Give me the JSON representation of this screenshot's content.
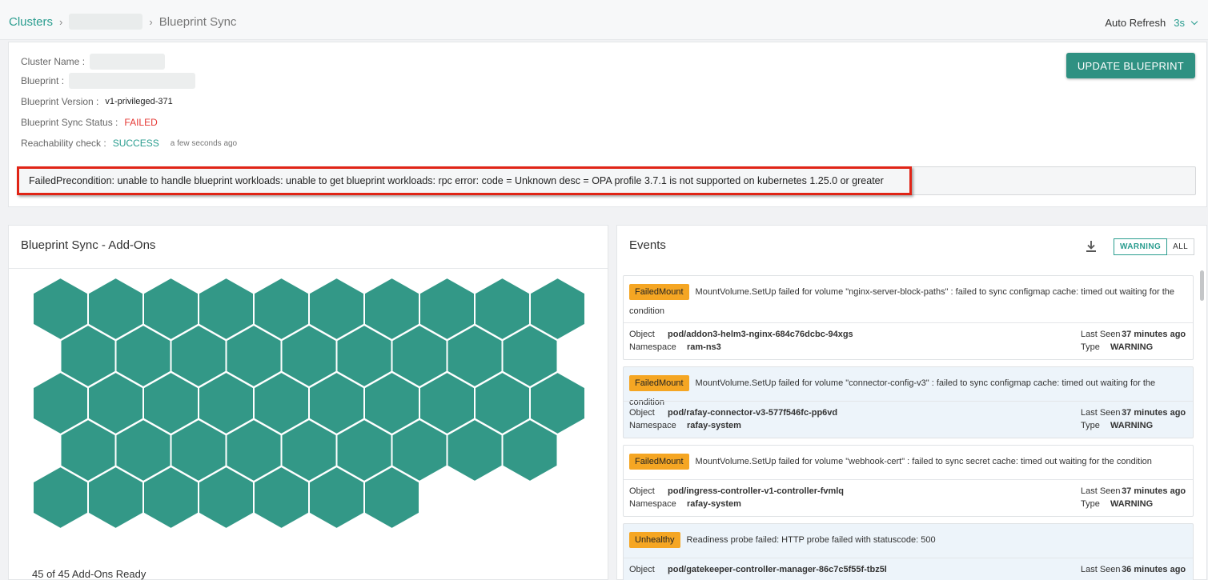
{
  "breadcrumb": {
    "root": "Clusters",
    "current": "Blueprint Sync"
  },
  "auto_refresh": {
    "label": "Auto Refresh",
    "value": "3s"
  },
  "info": {
    "cluster_name_label": "Cluster Name :",
    "blueprint_label": "Blueprint :",
    "version_label": "Blueprint Version :",
    "version_value": "v1-privileged-371",
    "sync_status_label": "Blueprint Sync Status :",
    "sync_status_value": "FAILED",
    "reach_label": "Reachability check :",
    "reach_value": "SUCCESS",
    "reach_time": "a few seconds ago",
    "update_button": "UPDATE BLUEPRINT",
    "error_message": "FailedPrecondition: unable to handle blueprint workloads: unable to get blueprint workloads: rpc error: code = Unknown desc = OPA profile 3.7.1 is not supported on kubernetes 1.25.0 or greater"
  },
  "addons": {
    "title": "Blueprint Sync - Add-Ons",
    "ready_text": "45 of 45 Add-Ons Ready",
    "ready_count": 45,
    "total": 45,
    "hex_color": "#339887"
  },
  "events": {
    "title": "Events",
    "filters": [
      "WARNING",
      "ALL"
    ],
    "active_filter": "WARNING",
    "labels": {
      "object": "Object",
      "namespace": "Namespace",
      "last_seen": "Last Seen",
      "type": "Type"
    },
    "items": [
      {
        "tag": "FailedMount",
        "message": "MountVolume.SetUp failed for volume \"nginx-server-block-paths\" : failed to sync configmap cache: timed out waiting for the condition",
        "object": "pod/addon3-helm3-nginx-684c76dcbc-94xgs",
        "namespace": "ram-ns3",
        "last_seen": "37 minutes ago",
        "type": "WARNING"
      },
      {
        "tag": "FailedMount",
        "message": "MountVolume.SetUp failed for volume \"connector-config-v3\" : failed to sync configmap cache: timed out waiting for the condition",
        "object": "pod/rafay-connector-v3-577f546fc-pp6vd",
        "namespace": "rafay-system",
        "last_seen": "37 minutes ago",
        "type": "WARNING"
      },
      {
        "tag": "FailedMount",
        "message": "MountVolume.SetUp failed for volume \"webhook-cert\" : failed to sync secret cache: timed out waiting for the condition",
        "object": "pod/ingress-controller-v1-controller-fvmlq",
        "namespace": "rafay-system",
        "last_seen": "37 minutes ago",
        "type": "WARNING"
      },
      {
        "tag": "Unhealthy",
        "message": "Readiness probe failed: HTTP probe failed with statuscode: 500",
        "object": "pod/gatekeeper-controller-manager-86c7c5f55f-tbz5l",
        "namespace": "",
        "last_seen": "36 minutes ago",
        "type": ""
      }
    ]
  }
}
